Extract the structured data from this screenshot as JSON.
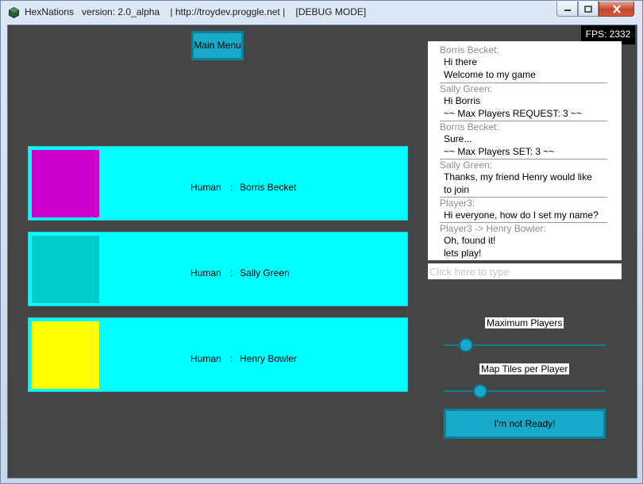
{
  "window": {
    "title": "HexNations   version: 2.0_alpha    | http://troydev.proggle.net |    [DEBUG MODE]",
    "buttons": {
      "minimize": "minimize",
      "maximize": "maximize",
      "close": "close"
    }
  },
  "fps": "FPS: 2332",
  "main_menu_label": "Main Menu",
  "players": [
    {
      "type": "Human",
      "sep": ":",
      "name": "Borris Becket",
      "color": "#cc00cc"
    },
    {
      "type": "Human",
      "sep": ":",
      "name": "Sally Green",
      "color": "#00cccc"
    },
    {
      "type": "Human",
      "sep": ":",
      "name": "Henry Bowler",
      "color": "#ffff00"
    }
  ],
  "chat": {
    "messages": [
      {
        "sender": "Borris Becket:",
        "lines": [
          "Hi there",
          "Welcome to my game"
        ]
      },
      {
        "sender": "Sally Green:",
        "lines": [
          "Hi Borris",
          "~~ Max Players REQUEST: 3 ~~"
        ]
      },
      {
        "sender": "Borris Becket:",
        "lines": [
          "Sure...",
          "~~ Max Players SET: 3 ~~"
        ]
      },
      {
        "sender": "Sally Green:",
        "lines": [
          "Thanks, my friend Henry would like",
          "to join"
        ]
      },
      {
        "sender": "Player3:",
        "lines": [
          "Hi everyone, how do I set my name?"
        ]
      },
      {
        "sender": "Player3 -> Henry Bowler:",
        "lines": [
          "Oh, found it!",
          "lets play!"
        ]
      }
    ],
    "input_placeholder": "Click here to type"
  },
  "settings": {
    "max_players": {
      "label": "Maximum Players",
      "level": 0.1
    },
    "map_tiles": {
      "label": "Map Tiles per Player",
      "level": 0.2
    }
  },
  "ready_label": "I'm not Ready!"
}
